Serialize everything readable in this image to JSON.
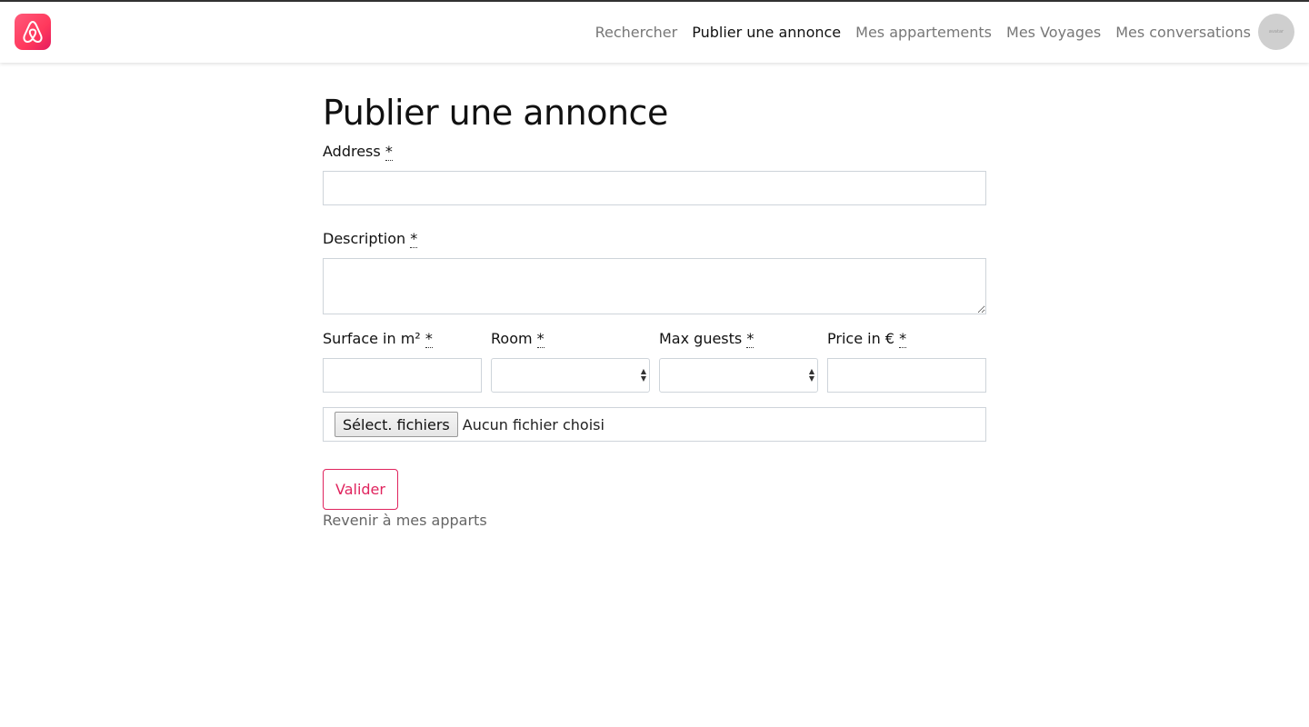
{
  "nav": {
    "items": [
      {
        "label": "Rechercher",
        "active": false
      },
      {
        "label": "Publier une annonce",
        "active": true
      },
      {
        "label": "Mes appartements",
        "active": false
      },
      {
        "label": "Mes Voyages",
        "active": false
      },
      {
        "label": "Mes conversations",
        "active": false
      }
    ],
    "logo_icon": "airbnb-logo-icon",
    "avatar_text": "avatar"
  },
  "form": {
    "title": "Publier une annonce",
    "required_mark": "*",
    "address_label": "Address",
    "description_label": "Description",
    "surface_label": "Surface in m²",
    "room_label": "Room",
    "max_guests_label": "Max guests",
    "price_label": "Price in €",
    "file_button": "Sélect. fichiers",
    "file_status": "Aucun fichier choisi",
    "submit": "Valider",
    "back": "Revenir à mes apparts"
  },
  "colors": {
    "brand": "#ff385c",
    "accent": "#e0245e"
  }
}
